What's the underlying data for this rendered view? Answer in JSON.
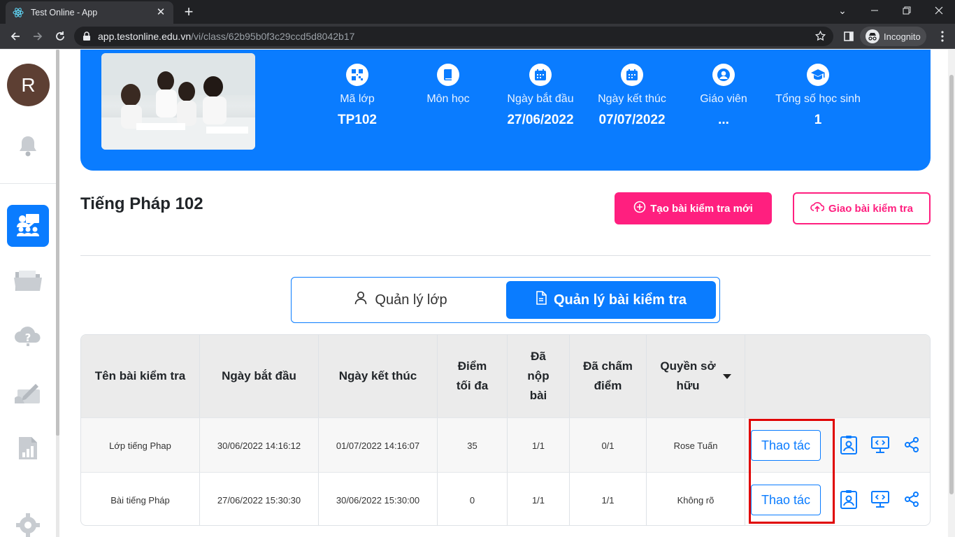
{
  "browser": {
    "tab_title": "Test Online - App",
    "url_host": "app.testonline.edu.vn",
    "url_path": "/vi/class/62b95b0f3c29ccd5d8042b17",
    "incognito_label": "Incognito"
  },
  "sidebar": {
    "avatar_initial": "R",
    "active_item": "class-management"
  },
  "class_info": {
    "items": [
      {
        "label": "Mã lớp",
        "value": "TP102"
      },
      {
        "label": "Môn học",
        "value": ""
      },
      {
        "label": "Ngày bắt đầu",
        "value": "27/06/2022"
      },
      {
        "label": "Ngày kết thúc",
        "value": "07/07/2022"
      },
      {
        "label": "Giáo viên",
        "value": "..."
      },
      {
        "label": "Tổng số học sinh",
        "value": "1"
      }
    ]
  },
  "page": {
    "class_title": "Tiếng Pháp 102",
    "create_test_label": "Tạo bài kiểm tra mới",
    "assign_test_label": "Giao bài kiểm tra"
  },
  "tabs": {
    "manage_class": "Quản lý lớp",
    "manage_tests": "Quản lý bài kiểm tra",
    "active": "manage_tests"
  },
  "table": {
    "headers": {
      "name": "Tên bài kiểm tra",
      "start": "Ngày bắt đầu",
      "end": "Ngày kết thúc",
      "max_score_1": "Điểm",
      "max_score_2": "tối đa",
      "submitted_1": "Đã",
      "submitted_2": "nộp",
      "submitted_3": "bài",
      "graded_1": "Đã chấm",
      "graded_2": "điểm",
      "owner_1": "Quyền sở",
      "owner_2": "hữu"
    },
    "rows": [
      {
        "name": "Lớp tiếng Phap",
        "start": "30/06/2022 14:16:12",
        "end": "01/07/2022 14:16:07",
        "max_score": "35",
        "submitted": "1/1",
        "graded": "0/1",
        "owner": "Rose Tuấn",
        "action": "Thao tác"
      },
      {
        "name": "Bài tiếng Pháp",
        "start": "27/06/2022 15:30:30",
        "end": "30/06/2022 15:30:00",
        "max_score": "0",
        "submitted": "1/1",
        "graded": "1/1",
        "owner": "Không rõ",
        "action": "Thao tác"
      }
    ]
  },
  "colors": {
    "primary": "#0a7cff",
    "accent": "#ff1f7f",
    "highlight": "#e00000"
  }
}
